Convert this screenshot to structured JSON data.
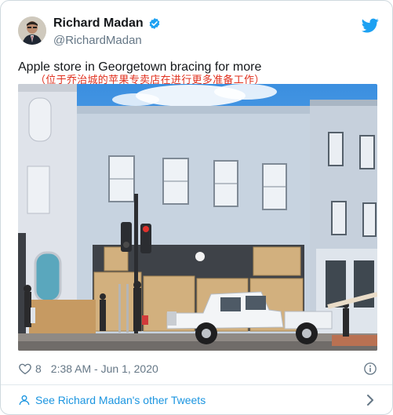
{
  "author": {
    "display_name": "Richard Madan",
    "handle": "@RichardMadan",
    "verified": true
  },
  "tweet": {
    "text": "Apple store in Georgetown bracing for more",
    "translation": "（位于乔治城的苹果专卖店在进行更多准备工作）"
  },
  "meta": {
    "like_count": "8",
    "timestamp": "2:38 AM - Jun 1, 2020"
  },
  "footer": {
    "link_text": "See Richard Madan's other Tweets"
  },
  "colors": {
    "brand_blue": "#1da1f2",
    "link_blue": "#1b95e0",
    "muted_text": "#657786",
    "translation_red": "#e0301e"
  },
  "icons": {
    "verified": "verified-badge-icon",
    "twitter": "twitter-bird-icon",
    "like": "heart-icon",
    "info": "info-icon",
    "profile": "user-icon",
    "chevron": "chevron-right-icon"
  }
}
